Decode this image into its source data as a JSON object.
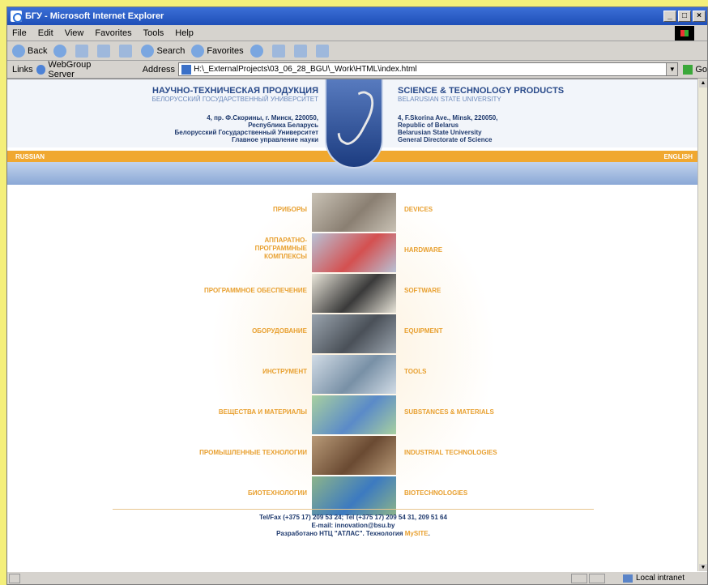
{
  "window": {
    "title": "БГУ - Microsoft Internet Explorer",
    "buttons": [
      "_",
      "□",
      "×"
    ]
  },
  "menu": [
    "File",
    "Edit",
    "View",
    "Favorites",
    "Tools",
    "Help"
  ],
  "toolbar": {
    "back": "Back",
    "search": "Search",
    "favorites": "Favorites"
  },
  "addressbar": {
    "links_label": "Links",
    "link_item": "WebGroup Server",
    "address_label": "Address",
    "url": "H:\\_ExternalProjects\\03_06_28_BGU\\_Work\\HTML\\index.html",
    "go_label": "Go"
  },
  "header": {
    "ru_title": "НАУЧНО-ТЕХНИЧЕСКАЯ ПРОДУКЦИЯ",
    "ru_sub": "БЕЛОРУССКИЙ ГОСУДАРСТВЕННЫЙ УНИВЕРСИТЕТ",
    "ru_addr": [
      "4, пр. Ф.Скорины, г. Минск, 220050,",
      "Республика Беларусь",
      "Белорусский Государственный Университет",
      "Главное управление науки"
    ],
    "en_title": "SCIENCE & TECHNOLOGY PRODUCTS",
    "en_sub": "BELARUSIAN STATE UNIVERSITY",
    "en_addr": [
      "4, F.Skorina Ave., Minsk, 220050,",
      "Republic of Belarus",
      "Belarusian State University",
      "General Directorate of Science"
    ],
    "lang_ru": "RUSSIAN",
    "lang_en": "ENGLISH"
  },
  "categories": [
    {
      "ru": "ПРИБОРЫ",
      "en": "DEVICES",
      "colors": [
        "#c9c2b5",
        "#8a7f72"
      ]
    },
    {
      "ru": "АППАРАТНО-ПРОГРАММНЫЕ КОМПЛЕКСЫ",
      "en": "HARDWARE",
      "colors": [
        "#b8c2d6",
        "#d45050"
      ]
    },
    {
      "ru": "ПРОГРАММНОЕ ОБЕСПЕЧЕНИЕ",
      "en": "SOFTWARE",
      "colors": [
        "#e8e4d8",
        "#3a3a3a"
      ]
    },
    {
      "ru": "ОБОРУДОВАНИЕ",
      "en": "EQUIPMENT",
      "colors": [
        "#9aa4ae",
        "#4a5058"
      ]
    },
    {
      "ru": "ИНСТРУМЕНТ",
      "en": "TOOLS",
      "colors": [
        "#d2dce6",
        "#7890a6"
      ]
    },
    {
      "ru": "ВЕЩЕСТВА И МАТЕРИАЛЫ",
      "en": "SUBSTANCES & MATERIALS",
      "colors": [
        "#a8d0a0",
        "#5a8ac8"
      ]
    },
    {
      "ru": "ПРОМЫШЛЕННЫЕ ТЕХНОЛОГИИ",
      "en": "INDUSTRIAL TECHNOLOGIES",
      "colors": [
        "#b89a78",
        "#6a4a32"
      ]
    },
    {
      "ru": "БИОТЕХНОЛОГИИ",
      "en": "BIOTECHNOLOGIES",
      "colors": [
        "#8cb48a",
        "#3c7ac0"
      ]
    }
  ],
  "footer": {
    "line1": "Tel/Fax (+375 17) 209 53 24; Tel (+375 17) 209 54 31, 209 51 64",
    "line2": "E-mail: innovation@bsu.by",
    "line3_prefix": "Разработано НТЦ \"АТЛАС\". Технология ",
    "line3_highlight": "MySITE",
    "line3_suffix": "."
  },
  "status": {
    "zone": "Local intranet"
  }
}
